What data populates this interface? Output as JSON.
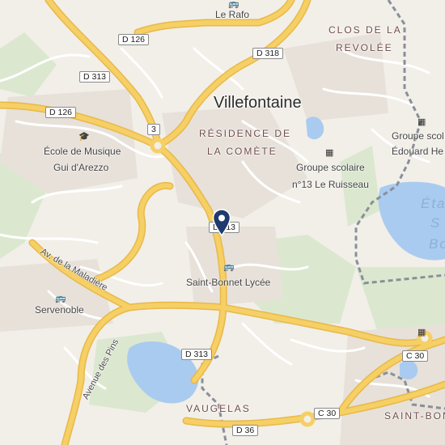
{
  "place_labels": {
    "city": "Villefontaine",
    "district_comete_line1": "RÉSIDENCE DE",
    "district_comete_line2": "LA COMÈTE",
    "district_clos_line1": "CLOS DE LA",
    "district_clos_line2": "REVOLÉE",
    "district_vaugelas": "VAUGELAS",
    "district_saint_bonnet": "SAINT-BONN",
    "lake_fragment_1": "Éta",
    "lake_fragment_2": "S",
    "lake_fragment_3": "Bo"
  },
  "street_labels": {
    "av_maladiere": "Av. de la Maladière",
    "avenue_des_pins": "Avenue des Pins"
  },
  "road_shields": {
    "d126_top": "D 126",
    "d313_top": "D 313",
    "d318": "D 318",
    "d126_left": "D 126",
    "route_3": "3",
    "d313_center": "D 313",
    "d313_south": "D 313",
    "c30_east": "C 30",
    "c30_south": "C 30",
    "d36": "D 36"
  },
  "pois": {
    "le_rafo": "Le Rafo",
    "ecole_line1": "École de Musique",
    "ecole_line2": "Gui d'Arezzo",
    "groupe13_line1": "Groupe scolaire",
    "groupe13_line2": "n°13 Le Ruisseau",
    "groupe_edouard_line1": "Groupe scol",
    "groupe_edouard_line2": "Édouard He",
    "saint_bonnet_lycee": "Saint-Bonnet Lycée",
    "servenoble": "Servenoble"
  },
  "colors": {
    "land": "#f2efe9",
    "major_road": "#f6cf65",
    "water": "#aacbf0",
    "park": "#dbe8cf",
    "boundary": "#8a8f99",
    "pin": "#1f3a6e"
  }
}
